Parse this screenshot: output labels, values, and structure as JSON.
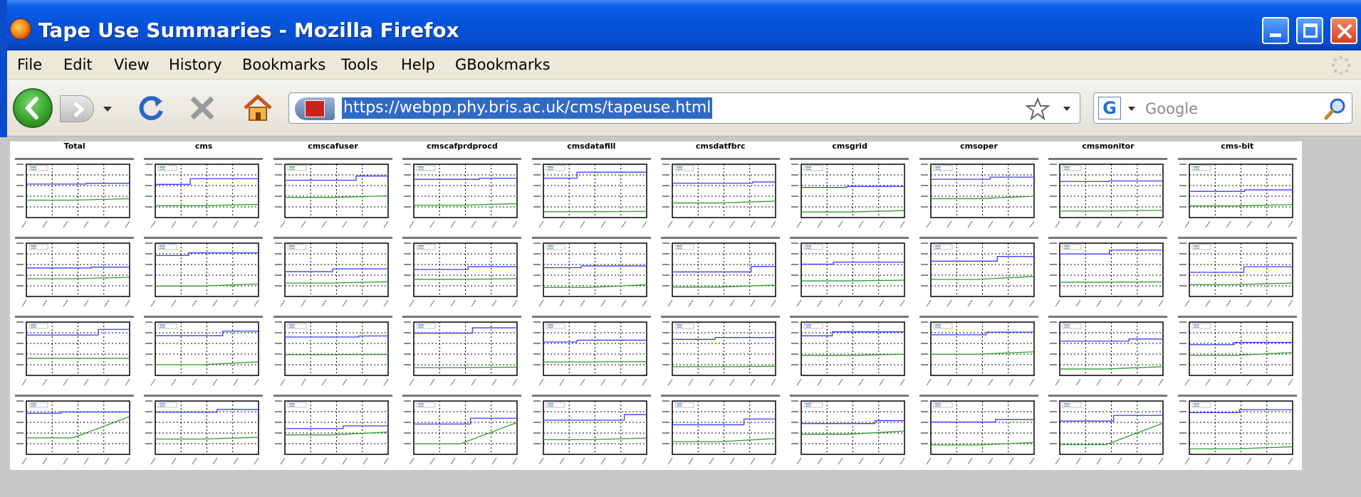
{
  "window": {
    "title": "Tape Use Summaries - Mozilla Firefox",
    "app_icon": "firefox-icon"
  },
  "menu": [
    "File",
    "Edit",
    "View",
    "History",
    "Bookmarks",
    "Tools",
    "Help",
    "GBookmarks"
  ],
  "navigation": {
    "url": "https://webpp.phy.bris.ac.uk/cms/tapeuse.html",
    "search_placeholder": "Google",
    "search_engine_icon": "G",
    "icons": [
      "back-arrow-icon",
      "forward-arrow-icon",
      "reload-icon",
      "stop-icon",
      "home-icon",
      "site-icon",
      "bookmark-star-icon",
      "search-magnifier-icon"
    ]
  },
  "plots": {
    "column_headers": [
      "Total",
      "cms",
      "cmscafuser",
      "cmscafprdprocd",
      "cmsdatafill",
      "cmsdatfbrc",
      "cmsgrid",
      "cmsoper",
      "cmsmonitor",
      "cms-bit"
    ],
    "row_count": 4,
    "colors": {
      "series_a": "#3b3bff",
      "series_b": "#2e9e2e",
      "grid": "#000000",
      "frame": "#000000"
    }
  }
}
